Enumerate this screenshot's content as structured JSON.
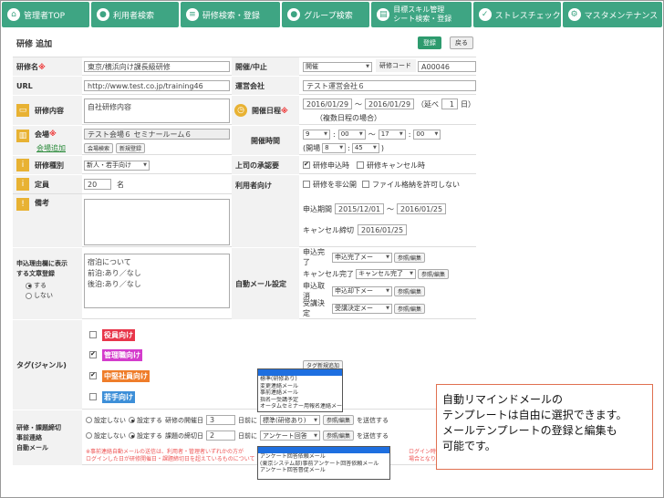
{
  "nav": {
    "tabs": [
      {
        "label": "管理者TOP",
        "icon": "home-icon",
        "glyph": "⌂"
      },
      {
        "label": "利用者検索",
        "icon": "user-icon",
        "glyph": "●"
      },
      {
        "label": "研修検索・登録",
        "icon": "list-icon",
        "glyph": "≡"
      },
      {
        "label": "グループ検索",
        "icon": "group-icon",
        "glyph": "●"
      },
      {
        "label_1": "目標スキル管理",
        "label_2": "シート検索・登録",
        "icon": "sheet-icon",
        "glyph": "▤"
      },
      {
        "label": "ストレスチェック",
        "icon": "check-icon",
        "glyph": "✓"
      },
      {
        "label": "マスタメンテナンス",
        "icon": "gear-icon",
        "glyph": "⚙"
      }
    ]
  },
  "page": {
    "title": "研修 追加",
    "register_label": "登録",
    "back_label": "戻る"
  },
  "form": {
    "training_name": {
      "label": "研修名",
      "value": "東京/横浜向け課長級研修"
    },
    "status": {
      "label": "開催/中止",
      "value": "開催"
    },
    "training_code": {
      "label": "研修コード",
      "value": "A00046"
    },
    "url": {
      "label": "URL",
      "value": "http://www.test.co.jp/training46"
    },
    "organizer": {
      "label": "運営会社",
      "value": "テスト運営会社６"
    },
    "content": {
      "label": "研修内容",
      "value": "自社研修内容"
    },
    "schedule": {
      "label": "開催日程",
      "start": "2016/01/29",
      "tilde": "～",
      "end": "2016/01/29",
      "extend_prefix": "（延べ",
      "days": "1",
      "extend_suffix": "日）",
      "note": "（複数日程の場合）"
    },
    "venue": {
      "label": "会場",
      "value": "テスト会場６ セミナールーム６",
      "add_link": "会場追加",
      "search_btn": "会場検索",
      "new_btn": "新規登録"
    },
    "time": {
      "label": "開催時間",
      "start_h": "9",
      "colon": ":",
      "start_m": "00",
      "tilde": "～",
      "end_h": "17",
      "end_m": "00",
      "break_prefix": "(開場",
      "break_h": "8",
      "break_m": "45",
      "break_suffix": ")"
    },
    "type": {
      "label": "研修種別",
      "value": "新人・若手向け"
    },
    "approval": {
      "label": "上司の承認要",
      "opt1": "研修申込時",
      "opt2": "研修キャンセル時"
    },
    "capacity": {
      "label": "定員",
      "value": "20",
      "unit": "名"
    },
    "user_dir": {
      "label": "利用者向け",
      "opt1": "研修を非公開",
      "opt2": "ファイル格納を許可しない",
      "apply_label": "申込期間",
      "apply_start": "2015/12/01",
      "tilde": "～",
      "apply_end": "2016/01/25",
      "cancel_label": "キャンセル締切",
      "cancel_date": "2016/01/25"
    },
    "remarks": {
      "label": "備考"
    },
    "reason": {
      "label_1": "申込理由欄に表示",
      "label_2": "する文章登録",
      "yes": "する",
      "no": "しない",
      "text_1": "宿泊について",
      "text_2": "前泊:あり／なし",
      "text_3": "後泊:あり／なし"
    },
    "auto_mail": {
      "label": "自動メール設定",
      "rows": [
        {
          "name": "申込完了",
          "select": "申込完了メー",
          "btn": "参照/編集"
        },
        {
          "name": "キャンセル完了",
          "select": "キャンセル完了",
          "btn": "参照/編集"
        },
        {
          "name": "申込取消",
          "select": "申込却下メー",
          "btn": "参照/編集"
        },
        {
          "name": "受講決定",
          "select": "受講決定メー",
          "btn": "参照/編集"
        }
      ]
    },
    "tags": {
      "label": "タグ(ジャンル)",
      "items": [
        {
          "label": "役員向け",
          "checked": false,
          "color": "#e8364a"
        },
        {
          "label": "管理職向け",
          "checked": true,
          "color": "#d43ccc"
        },
        {
          "label": "中堅社員向け",
          "checked": true,
          "color": "#ef7d2a"
        },
        {
          "label": "若手向け",
          "checked": false,
          "color": "#3d8fd8"
        }
      ],
      "new_tag_btn": "タグ新規追加"
    },
    "reminder": {
      "label_1": "研修・課題締切",
      "label_2": "事前連絡",
      "label_3": "自動メール",
      "row1": {
        "off": "設定しない",
        "on": "設定する",
        "ref": "研修の開催日",
        "days": "3",
        "before": "日前に",
        "select": "標準(研修あり)",
        "btn": "参照/編集",
        "send": "を送信する"
      },
      "row2": {
        "off": "設定しない",
        "on": "設定する",
        "ref": "課題の締切日",
        "days": "2",
        "before": "日前に",
        "select": "アンケート回答",
        "btn": "参照/編集",
        "send": "を送信する"
      },
      "note_1": "※事前連絡自動メールの送信は、利用者・管理者いずれかの方が",
      "note_1b": "ログイン時）。",
      "note_2": "ログインした日が研修開催日・課題締切日を超えているものについて",
      "note_2b": "場合となります。"
    },
    "popup_1": [
      "標準(研修あり)",
      "変更連絡メール",
      "事前連絡メール",
      "指名一受講予定",
      "オータムセミナー用報名連絡メール"
    ],
    "popup_2": [
      "アンケート回答依頼メール",
      "(東京システム部)事前アンケート回答依頼メール",
      "アンケート回答督促メール"
    ]
  },
  "callout": {
    "line_1": "自動リマインドメールの",
    "line_2": "テンプレートは自由に選択できます。",
    "line_3": "メールテンプレートの登録と編集も",
    "line_4": "可能です。"
  }
}
